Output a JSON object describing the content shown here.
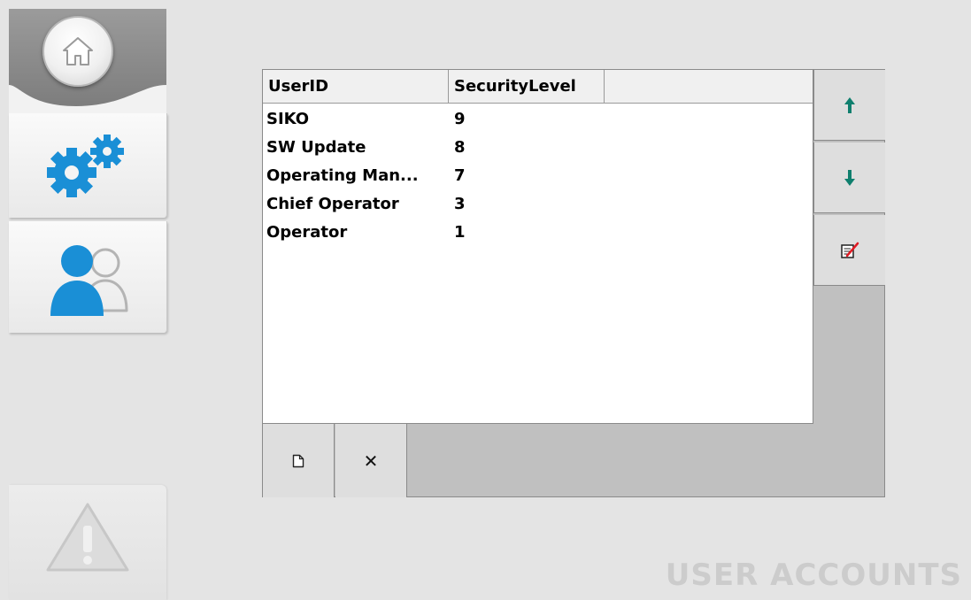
{
  "navigation": {
    "home_icon": "home-icon",
    "settings_icon": "gears-icon",
    "users_icon": "users-icon",
    "alarm_icon": "warning-icon",
    "accent_color": "#1a8fd6"
  },
  "table": {
    "columns": [
      "UserID",
      "SecurityLevel",
      ""
    ],
    "rows": [
      {
        "user_id": "SIKO",
        "security_level": "9"
      },
      {
        "user_id": "SW Update",
        "security_level": "8"
      },
      {
        "user_id": "Operating Man...",
        "security_level": "7"
      },
      {
        "user_id": "Chief Operator",
        "security_level": "3"
      },
      {
        "user_id": "Operator",
        "security_level": "1"
      }
    ]
  },
  "actions": {
    "move_up_icon": "arrow-up-icon",
    "move_down_icon": "arrow-down-icon",
    "edit_icon": "edit-icon",
    "new_icon": "new-document-icon",
    "delete_label": "✕",
    "arrow_color": "#0f7f6e"
  },
  "page": {
    "title": "USER ACCOUNTS"
  }
}
